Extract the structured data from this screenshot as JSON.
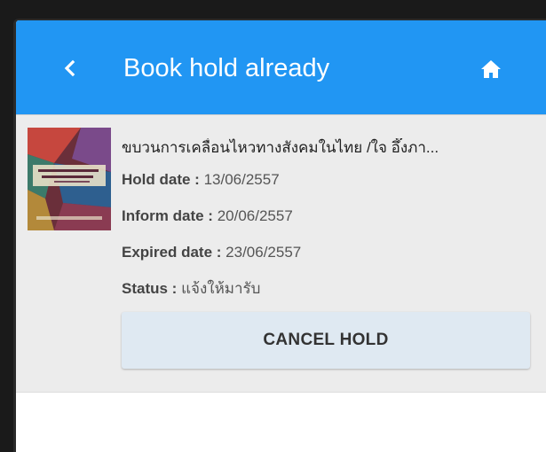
{
  "appbar": {
    "title": "Book hold already",
    "back_icon": "chevron-left-icon",
    "home_icon": "home-icon",
    "color": "#2196f3"
  },
  "hold": {
    "book_title": "ขบวนการเคลื่อนไหวทางสังคมในไทย /ใจ อึ๊งภา...",
    "hold_label": "Hold date :",
    "hold_value": "13/06/2557",
    "inform_label": "Inform date :",
    "inform_value": "20/06/2557",
    "expired_label": "Expired date :",
    "expired_value": "23/06/2557",
    "status_label": "Status :",
    "status_value": "แจ้งให้มารับ",
    "cancel_label": "CANCEL HOLD"
  }
}
